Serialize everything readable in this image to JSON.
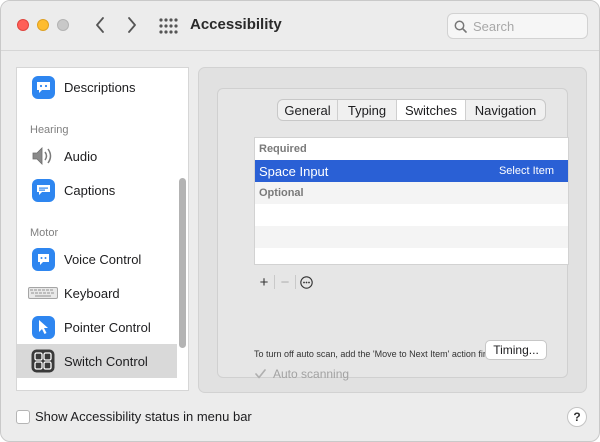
{
  "window": {
    "title": "Accessibility"
  },
  "search": {
    "placeholder": "Search"
  },
  "sidebar": {
    "items": [
      {
        "label": "Descriptions",
        "icon": "descriptions-icon"
      },
      {
        "label": "Audio",
        "icon": "speaker-icon"
      },
      {
        "label": "Captions",
        "icon": "captions-icon"
      },
      {
        "label": "Voice Control",
        "icon": "voice-control-icon"
      },
      {
        "label": "Keyboard",
        "icon": "keyboard-icon"
      },
      {
        "label": "Pointer Control",
        "icon": "pointer-icon"
      },
      {
        "label": "Switch Control",
        "icon": "switch-control-icon"
      }
    ],
    "sections": {
      "hearing": "Hearing",
      "motor": "Motor"
    },
    "selected": "Switch Control"
  },
  "tabs": [
    {
      "label": "General"
    },
    {
      "label": "Typing"
    },
    {
      "label": "Switches"
    },
    {
      "label": "Navigation"
    }
  ],
  "active_tab": "Switches",
  "switch_list": {
    "required_header": "Required",
    "optional_header": "Optional",
    "selected_row": {
      "name": "Space Input",
      "action": "Select Item"
    }
  },
  "controls": {
    "add": "+",
    "remove": "−",
    "more": "⋯"
  },
  "note": "To turn off auto scan, add the 'Move to Next Item' action first.",
  "auto_scanning": {
    "label": "Auto scanning",
    "checked": true,
    "enabled": false
  },
  "timing_button": "Timing...",
  "footer": {
    "status_label": "Show Accessibility status in menu bar",
    "help": "?"
  },
  "colors": {
    "accent": "#2a60d5",
    "icon_blue": "#2e86f0",
    "close": "#ff5f57",
    "minimize": "#febc2e"
  }
}
